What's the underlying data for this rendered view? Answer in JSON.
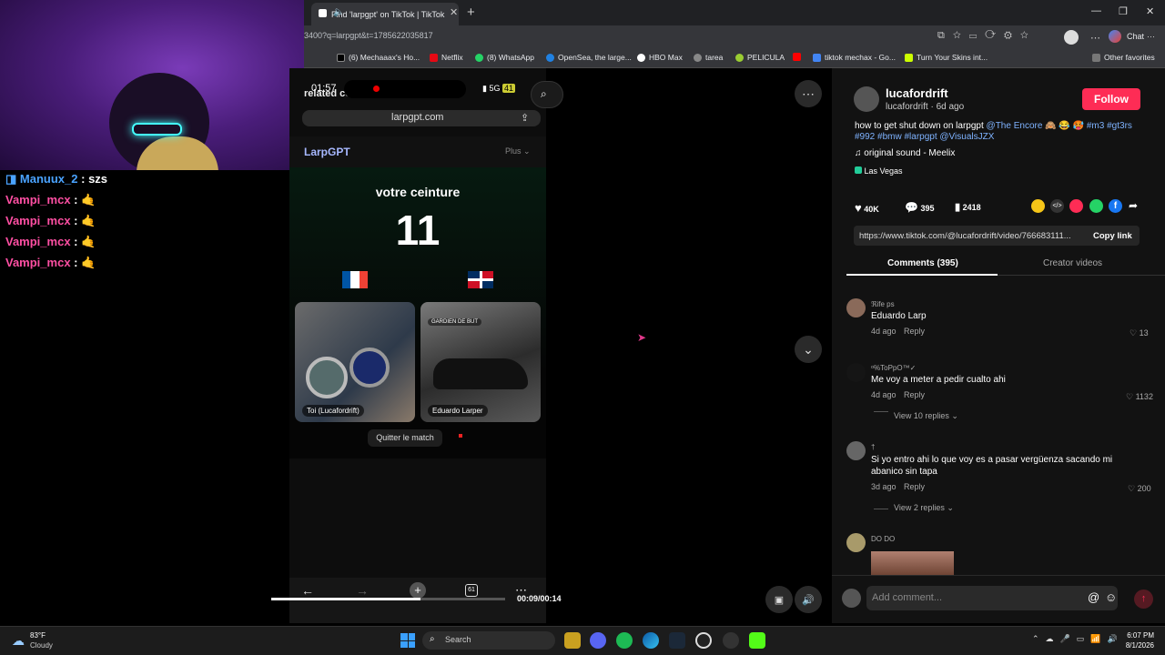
{
  "browser": {
    "tab_title": "Find 'larpgpt' on TikTok | TikTok",
    "url": "3400?q=larpgpt&t=1785622035817",
    "chat_label": "Chat",
    "bookmarks": [
      "(6) Mechaaax's Ho...",
      "Netflix",
      "(8) WhatsApp",
      "OpenSea, the large...",
      "HBO Max",
      "tarea",
      "PELICULA",
      "tiktok mechax - Go...",
      "Turn Your Skins int..."
    ],
    "other_favorites": "Other favorites"
  },
  "chat": {
    "messages": [
      {
        "user": "Manuux_2",
        "text": ": szs"
      },
      {
        "user": "Vampi_mcx",
        "text": ":"
      },
      {
        "user": "Vampi_mcx",
        "text": ":"
      },
      {
        "user": "Vampi_mcx",
        "text": ":"
      },
      {
        "user": "Vampi_mcx",
        "text": ":"
      }
    ]
  },
  "video": {
    "status_time": "01:57",
    "network": "5G",
    "battery": "41",
    "related": "related content",
    "phone_url": "larpgpt.com",
    "app_name": "LarpGPT",
    "plan": "Plus",
    "game_title": "votre ceinture",
    "game_number": "11",
    "card1_label": "Toi (Lucafordrift)",
    "card2_badge": "GARDIEN DE BUT",
    "card2_label": "Eduardo Larper",
    "quit_label": "Quitter le match",
    "time": "00:09/00:14",
    "progress": 0.64
  },
  "post": {
    "author": "lucafordrift",
    "author_sub": "lucafordrift · 6d ago",
    "follow": "Follow",
    "caption_plain": "how to get shut down on larpgpt",
    "caption_tags1": "@The Encore",
    "caption_tags2": "#m3 #gt3rs",
    "caption_tags3": "#992 #bmw #larpgpt @VisualsJZX",
    "sound": "original sound - Meelix",
    "location": "Las Vegas",
    "likes": "40K",
    "comments": "395",
    "saves": "2418",
    "link": "https://www.tiktok.com/@lucafordrift/video/766683111...",
    "copy_link": "Copy link",
    "tab_comments": "Comments (395)",
    "tab_creator": "Creator videos",
    "add_comment_placeholder": "Add comment..."
  },
  "comments": [
    {
      "user": "ℜife ps",
      "text": "Eduardo Larp",
      "age": "4d ago",
      "reply": "Reply",
      "likes": "13"
    },
    {
      "user": "ᵒ%ToPpO™✓",
      "text": "Me voy a meter a pedir cualto ahi",
      "age": "4d ago",
      "reply": "Reply",
      "likes": "1132",
      "replies": "View 10 replies"
    },
    {
      "user": "†",
      "text1": "Si yo entro ahi lo que voy es a pasar vergüenza sacando mi",
      "text2": "abanico sin tapa",
      "age": "3d ago",
      "reply": "Reply",
      "likes": "200",
      "replies": "View 2 replies"
    },
    {
      "user": "DO DO"
    }
  ],
  "taskbar": {
    "temp": "83°F",
    "weather": "Cloudy",
    "search": "Search",
    "time": "6:07 PM",
    "date": "8/1/2026"
  }
}
